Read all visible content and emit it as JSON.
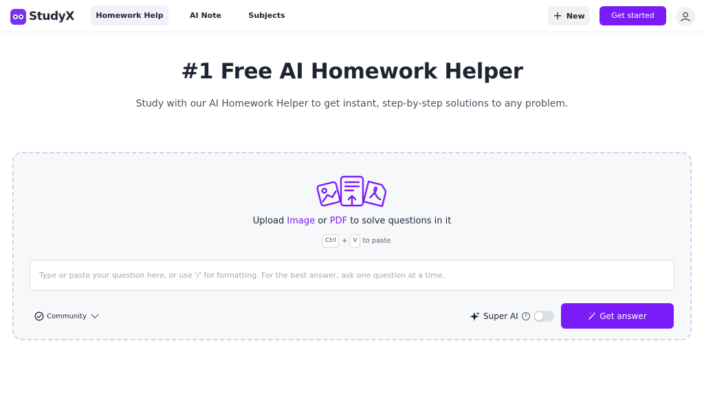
{
  "brand": {
    "name": "StudyX",
    "color": "#7a1cf7"
  },
  "nav": {
    "tabs": [
      {
        "label": "Homework Help",
        "active": true
      },
      {
        "label": "AI Note",
        "active": false
      },
      {
        "label": "Subjects",
        "active": false
      }
    ],
    "new_label": "New",
    "get_started_label": "Get started",
    "avatar_icon": "user-icon"
  },
  "hero": {
    "title": "#1 Free AI Homework Helper",
    "subtitle": "Study with our AI Homework Helper to get instant, step-by-step solutions to any problem."
  },
  "upload": {
    "icon": "upload-documents-icon",
    "prefix": "Upload",
    "image_link": "Image",
    "or_text": "or",
    "pdf_link": "PDF",
    "suffix": "to solve questions in it",
    "key_ctrl": "Ctrl",
    "key_plus": "+",
    "key_v": "V",
    "paste_text": "to paste"
  },
  "question": {
    "value": "",
    "placeholder": "Type or paste your question here, or use '/' for formatting. For the best answer, ask one question at a time."
  },
  "footer": {
    "community_label": "Community",
    "super_ai_label": "Super AI",
    "super_ai_enabled": false,
    "help_icon": "question-circle-icon",
    "get_answer_label": "Get answer"
  }
}
